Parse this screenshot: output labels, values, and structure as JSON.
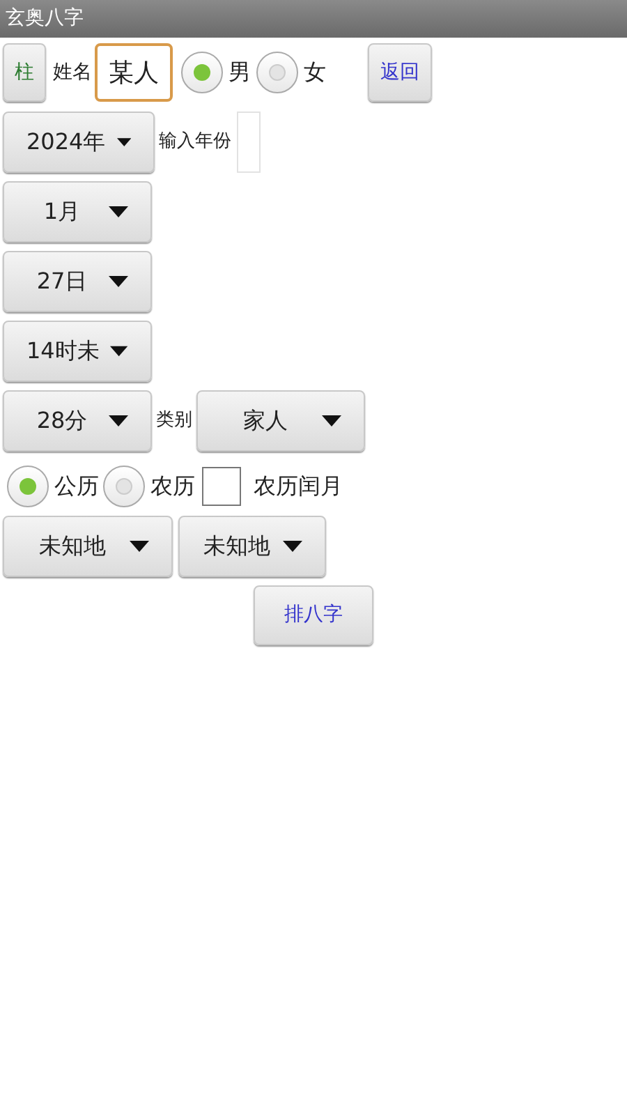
{
  "window": {
    "title": "玄奥八字"
  },
  "top_row": {
    "pillar_button": "柱",
    "name_label": "姓名",
    "name_value": "某人",
    "gender_options": [
      {
        "label": "男",
        "selected": true
      },
      {
        "label": "女",
        "selected": false
      }
    ],
    "back_button": "返回"
  },
  "year_row": {
    "spinner": "2024年",
    "input_label": "输入年份"
  },
  "month_spinner": "1月",
  "day_spinner": "27日",
  "hour_spinner": "14时未",
  "minute_row": {
    "spinner": "28分",
    "category_label": "类别",
    "category_spinner": "家人"
  },
  "calendar_options": [
    {
      "label": "公历",
      "selected": true
    },
    {
      "label": "农历",
      "selected": false
    }
  ],
  "leap_month": {
    "label": "农历闰月",
    "checked": false
  },
  "location_spinners": [
    "未知地",
    "未知地"
  ],
  "submit_button": "排八字"
}
